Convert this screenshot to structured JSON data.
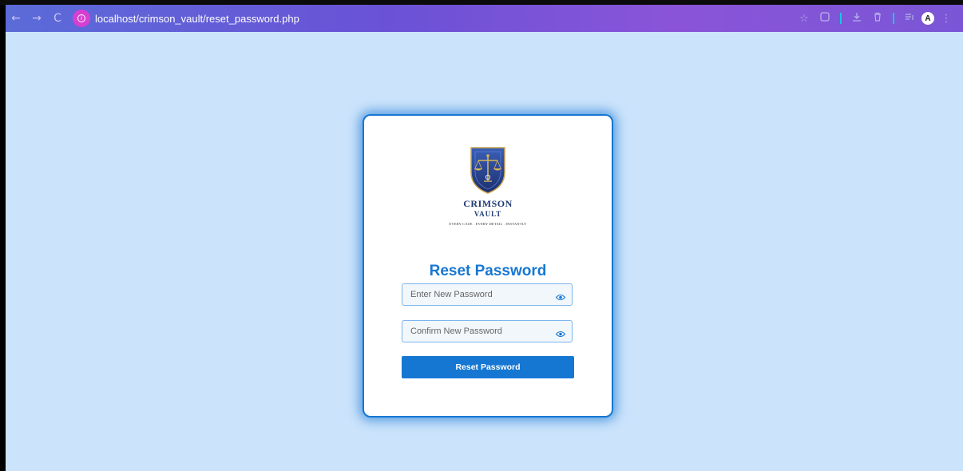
{
  "browser": {
    "back_icon": "←",
    "forward_icon": "→",
    "reload_icon": "C",
    "url": "localhost/crimson_vault/reset_password.php",
    "star_icon": "☆",
    "profile_initial": "A",
    "gradient_start": "#5b6bd8",
    "gradient_end": "#7a56d6"
  },
  "page": {
    "background": "#cbe3fb",
    "accent": "#1677d2"
  },
  "logo": {
    "name": "CRIMSON",
    "sub": "VAULT",
    "tagline": "EVERY CASE . EVERY DETAIL . INSTANTLY"
  },
  "form": {
    "title": "Reset Password",
    "new_password_placeholder": "Enter New Password",
    "new_password_value": "",
    "confirm_password_placeholder": "Confirm New Password",
    "confirm_password_value": "",
    "submit_label": "Reset Password"
  }
}
